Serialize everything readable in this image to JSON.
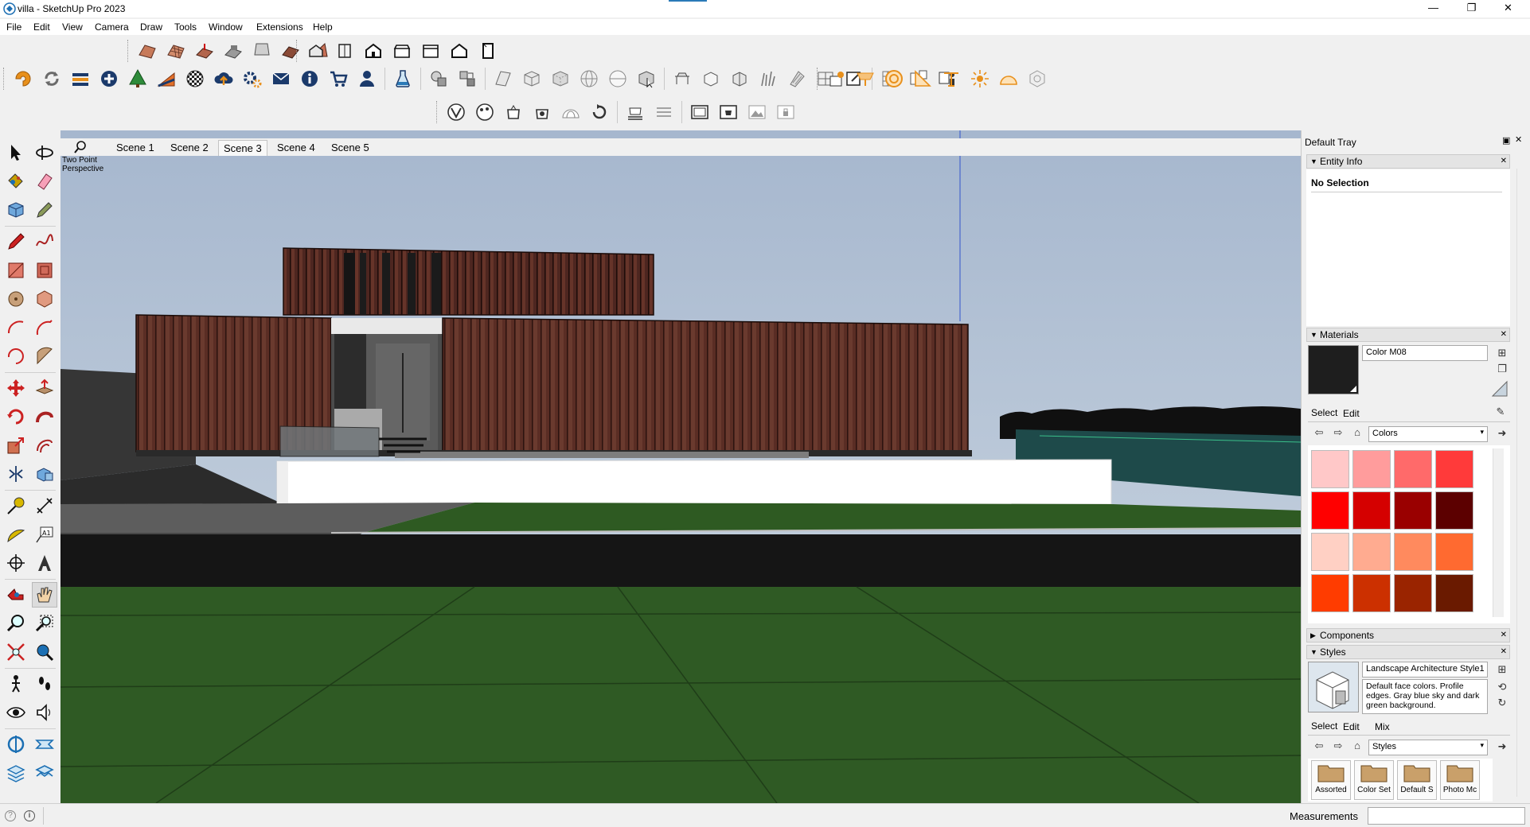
{
  "window": {
    "title": "villa - SketchUp Pro 2023",
    "minimize": "—",
    "maximize": "❐",
    "close": "✕"
  },
  "menu": {
    "items": [
      "File",
      "Edit",
      "View",
      "Camera",
      "Draw",
      "Tools",
      "Window",
      "Extensions",
      "Help"
    ]
  },
  "scenes": {
    "tabs": [
      "Scene 1",
      "Scene 2",
      "Scene 3",
      "Scene 4",
      "Scene 5"
    ],
    "active": "Scene 3"
  },
  "viewport": {
    "camera_label_line1": "Two Point",
    "camera_label_line2": "Perspective",
    "colors": {
      "sky_top": "#a8b8cf",
      "sky_bottom": "#c8d4e0",
      "grass": "#2f5a24",
      "wood": "#5a2e24"
    }
  },
  "tray": {
    "title": "Default Tray",
    "entity_info": {
      "header": "Entity Info",
      "selection": "No Selection"
    },
    "materials": {
      "header": "Materials",
      "material_name": "Color M08",
      "preview_color": "#1e1e1e",
      "tab_select": "Select",
      "tab_edit": "Edit",
      "library": "Colors",
      "swatches": [
        "#ffc8c8",
        "#ff9c9c",
        "#ff6a6a",
        "#ff3a3a",
        "#ff0000",
        "#d50000",
        "#9a0000",
        "#5c0000",
        "#ffd0c4",
        "#ffab90",
        "#ff8a5e",
        "#ff6a30",
        "#ff3c00",
        "#cc3000",
        "#9a2400",
        "#6a1a00"
      ]
    },
    "components": {
      "header": "Components"
    },
    "styles": {
      "header": "Styles",
      "style_name": "Landscape Architecture Style1",
      "description": "Default face colors. Profile edges. Gray blue sky and dark green background.",
      "tab_select": "Select",
      "tab_edit": "Edit",
      "tab_mix": "Mix",
      "library": "Styles",
      "folders": [
        "Assorted",
        "Color Set",
        "Default S",
        "Photo Mc"
      ]
    }
  },
  "status": {
    "measurements_label": "Measurements",
    "measurements_value": ""
  }
}
